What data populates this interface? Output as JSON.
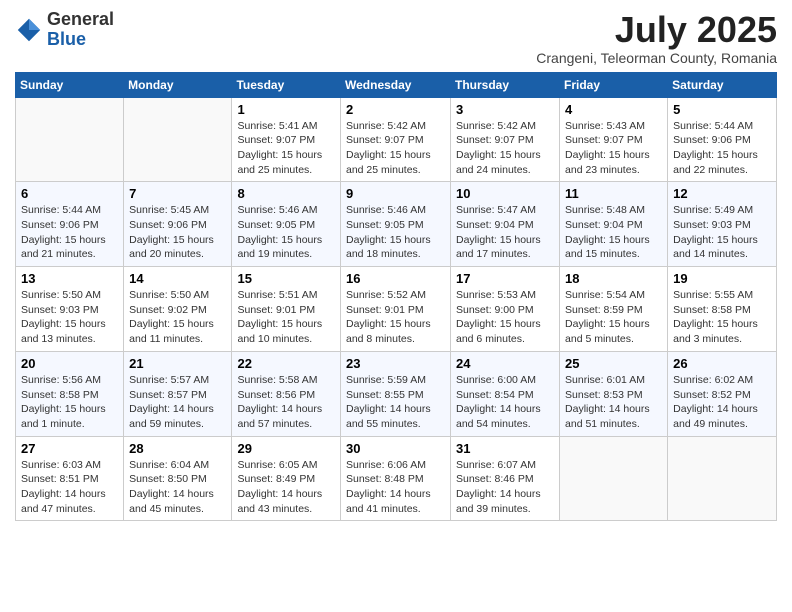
{
  "logo": {
    "general": "General",
    "blue": "Blue"
  },
  "header": {
    "month": "July 2025",
    "location": "Crangeni, Teleorman County, Romania"
  },
  "weekdays": [
    "Sunday",
    "Monday",
    "Tuesday",
    "Wednesday",
    "Thursday",
    "Friday",
    "Saturday"
  ],
  "weeks": [
    [
      {
        "day": "",
        "content": ""
      },
      {
        "day": "",
        "content": ""
      },
      {
        "day": "1",
        "content": "Sunrise: 5:41 AM\nSunset: 9:07 PM\nDaylight: 15 hours\nand 25 minutes."
      },
      {
        "day": "2",
        "content": "Sunrise: 5:42 AM\nSunset: 9:07 PM\nDaylight: 15 hours\nand 25 minutes."
      },
      {
        "day": "3",
        "content": "Sunrise: 5:42 AM\nSunset: 9:07 PM\nDaylight: 15 hours\nand 24 minutes."
      },
      {
        "day": "4",
        "content": "Sunrise: 5:43 AM\nSunset: 9:07 PM\nDaylight: 15 hours\nand 23 minutes."
      },
      {
        "day": "5",
        "content": "Sunrise: 5:44 AM\nSunset: 9:06 PM\nDaylight: 15 hours\nand 22 minutes."
      }
    ],
    [
      {
        "day": "6",
        "content": "Sunrise: 5:44 AM\nSunset: 9:06 PM\nDaylight: 15 hours\nand 21 minutes."
      },
      {
        "day": "7",
        "content": "Sunrise: 5:45 AM\nSunset: 9:06 PM\nDaylight: 15 hours\nand 20 minutes."
      },
      {
        "day": "8",
        "content": "Sunrise: 5:46 AM\nSunset: 9:05 PM\nDaylight: 15 hours\nand 19 minutes."
      },
      {
        "day": "9",
        "content": "Sunrise: 5:46 AM\nSunset: 9:05 PM\nDaylight: 15 hours\nand 18 minutes."
      },
      {
        "day": "10",
        "content": "Sunrise: 5:47 AM\nSunset: 9:04 PM\nDaylight: 15 hours\nand 17 minutes."
      },
      {
        "day": "11",
        "content": "Sunrise: 5:48 AM\nSunset: 9:04 PM\nDaylight: 15 hours\nand 15 minutes."
      },
      {
        "day": "12",
        "content": "Sunrise: 5:49 AM\nSunset: 9:03 PM\nDaylight: 15 hours\nand 14 minutes."
      }
    ],
    [
      {
        "day": "13",
        "content": "Sunrise: 5:50 AM\nSunset: 9:03 PM\nDaylight: 15 hours\nand 13 minutes."
      },
      {
        "day": "14",
        "content": "Sunrise: 5:50 AM\nSunset: 9:02 PM\nDaylight: 15 hours\nand 11 minutes."
      },
      {
        "day": "15",
        "content": "Sunrise: 5:51 AM\nSunset: 9:01 PM\nDaylight: 15 hours\nand 10 minutes."
      },
      {
        "day": "16",
        "content": "Sunrise: 5:52 AM\nSunset: 9:01 PM\nDaylight: 15 hours\nand 8 minutes."
      },
      {
        "day": "17",
        "content": "Sunrise: 5:53 AM\nSunset: 9:00 PM\nDaylight: 15 hours\nand 6 minutes."
      },
      {
        "day": "18",
        "content": "Sunrise: 5:54 AM\nSunset: 8:59 PM\nDaylight: 15 hours\nand 5 minutes."
      },
      {
        "day": "19",
        "content": "Sunrise: 5:55 AM\nSunset: 8:58 PM\nDaylight: 15 hours\nand 3 minutes."
      }
    ],
    [
      {
        "day": "20",
        "content": "Sunrise: 5:56 AM\nSunset: 8:58 PM\nDaylight: 15 hours\nand 1 minute."
      },
      {
        "day": "21",
        "content": "Sunrise: 5:57 AM\nSunset: 8:57 PM\nDaylight: 14 hours\nand 59 minutes."
      },
      {
        "day": "22",
        "content": "Sunrise: 5:58 AM\nSunset: 8:56 PM\nDaylight: 14 hours\nand 57 minutes."
      },
      {
        "day": "23",
        "content": "Sunrise: 5:59 AM\nSunset: 8:55 PM\nDaylight: 14 hours\nand 55 minutes."
      },
      {
        "day": "24",
        "content": "Sunrise: 6:00 AM\nSunset: 8:54 PM\nDaylight: 14 hours\nand 54 minutes."
      },
      {
        "day": "25",
        "content": "Sunrise: 6:01 AM\nSunset: 8:53 PM\nDaylight: 14 hours\nand 51 minutes."
      },
      {
        "day": "26",
        "content": "Sunrise: 6:02 AM\nSunset: 8:52 PM\nDaylight: 14 hours\nand 49 minutes."
      }
    ],
    [
      {
        "day": "27",
        "content": "Sunrise: 6:03 AM\nSunset: 8:51 PM\nDaylight: 14 hours\nand 47 minutes."
      },
      {
        "day": "28",
        "content": "Sunrise: 6:04 AM\nSunset: 8:50 PM\nDaylight: 14 hours\nand 45 minutes."
      },
      {
        "day": "29",
        "content": "Sunrise: 6:05 AM\nSunset: 8:49 PM\nDaylight: 14 hours\nand 43 minutes."
      },
      {
        "day": "30",
        "content": "Sunrise: 6:06 AM\nSunset: 8:48 PM\nDaylight: 14 hours\nand 41 minutes."
      },
      {
        "day": "31",
        "content": "Sunrise: 6:07 AM\nSunset: 8:46 PM\nDaylight: 14 hours\nand 39 minutes."
      },
      {
        "day": "",
        "content": ""
      },
      {
        "day": "",
        "content": ""
      }
    ]
  ]
}
